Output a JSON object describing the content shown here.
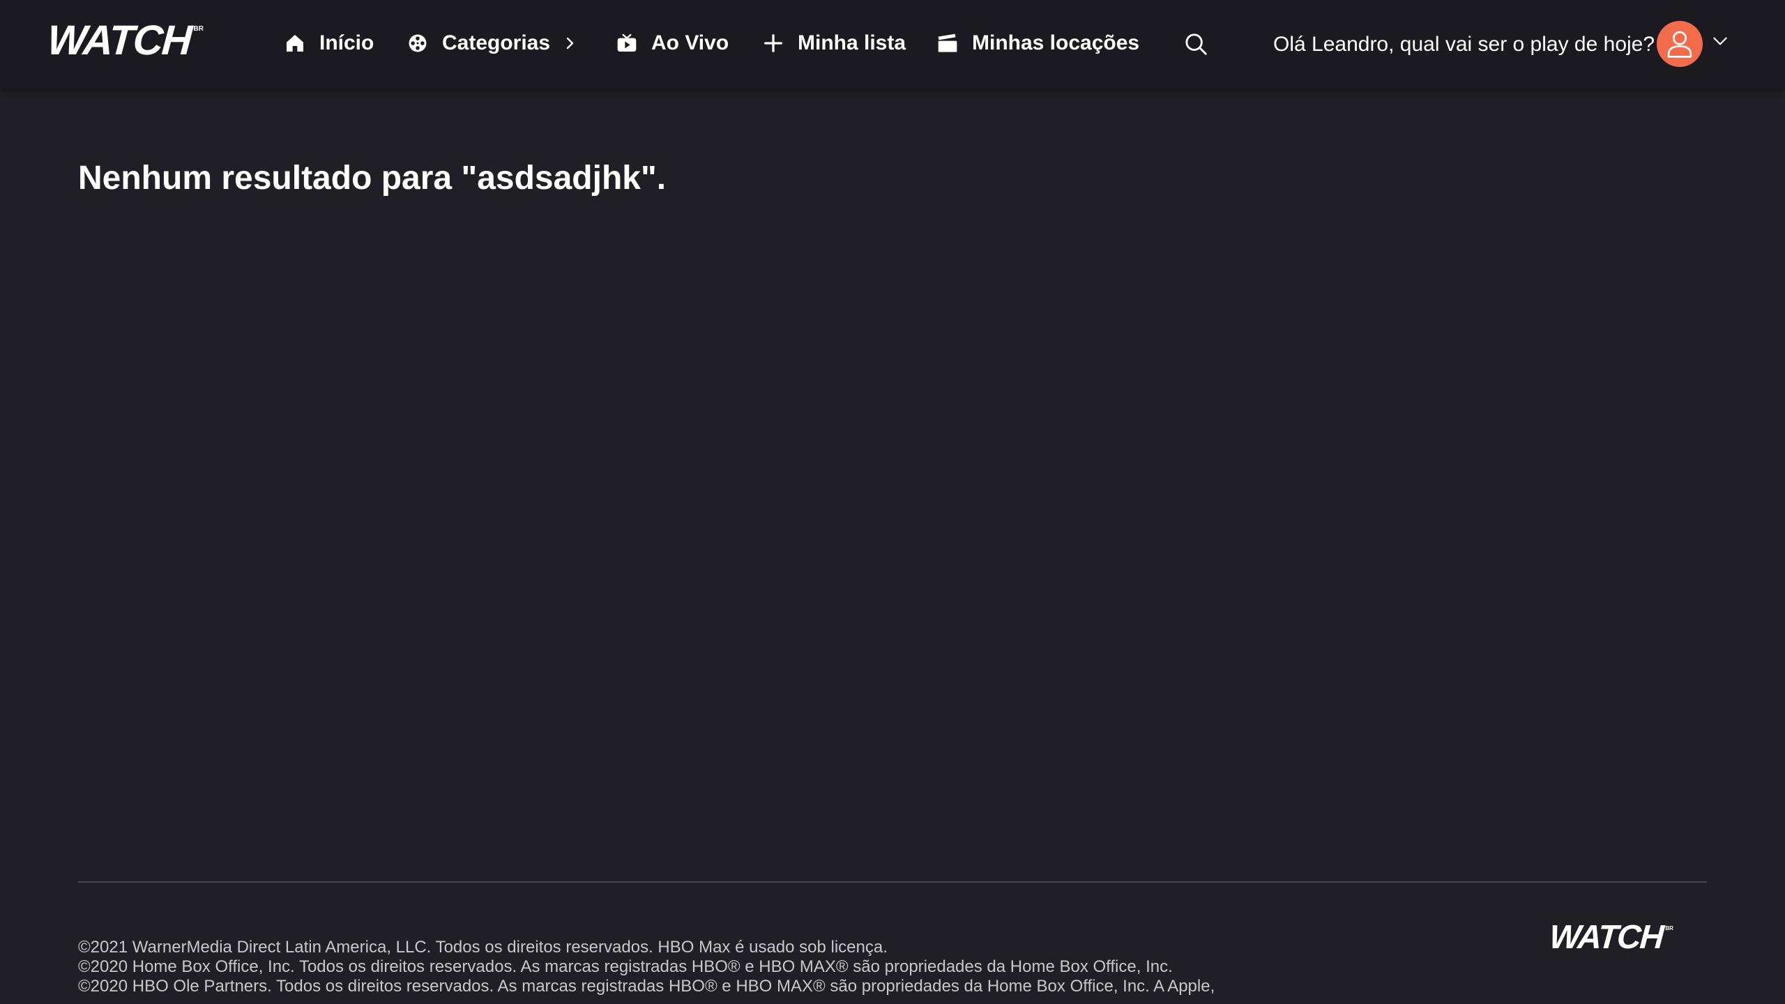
{
  "header": {
    "logo_text": "WATCH",
    "logo_superscript": "BR",
    "nav": {
      "inicio": "Início",
      "categorias": "Categorias",
      "ao_vivo": "Ao Vivo",
      "minha_lista": "Minha lista",
      "minhas_locacoes": "Minhas locações"
    },
    "greeting": "Olá Leandro, qual vai ser o play de hoje?",
    "icons": {
      "inicio": "home-icon",
      "categorias": "film-reel-icon",
      "ao_vivo": "live-tv-icon",
      "minha_lista": "plus-icon",
      "minhas_locacoes": "clapperboard-icon",
      "search": "search-icon",
      "avatar": "user-icon",
      "account_menu": "chevron-down-icon",
      "categorias_chevron": "chevron-right-icon"
    }
  },
  "main": {
    "results_message": "Nenhum resultado para \"asdsadjhk\"."
  },
  "footer": {
    "legal": [
      "©2021 WarnerMedia Direct Latin America, LLC. Todos os direitos reservados. HBO Max é usado sob licença.",
      "©2020 Home Box Office, Inc. Todos os direitos reservados. As marcas registradas HBO® e HBO MAX® são propriedades da Home Box Office, Inc.",
      "©2020 HBO Ole Partners. Todos os direitos reservados. As marcas registradas HBO® e HBO MAX® são propriedades da Home Box Office, Inc. A Apple,"
    ],
    "logo_text": "WATCH",
    "logo_superscript": "BR"
  },
  "colors": {
    "background": "#1f1f25",
    "header_background": "#1a1a20",
    "avatar": "#f26b4b",
    "footer_text": "#c8c8cc",
    "divider": "#44444c"
  }
}
